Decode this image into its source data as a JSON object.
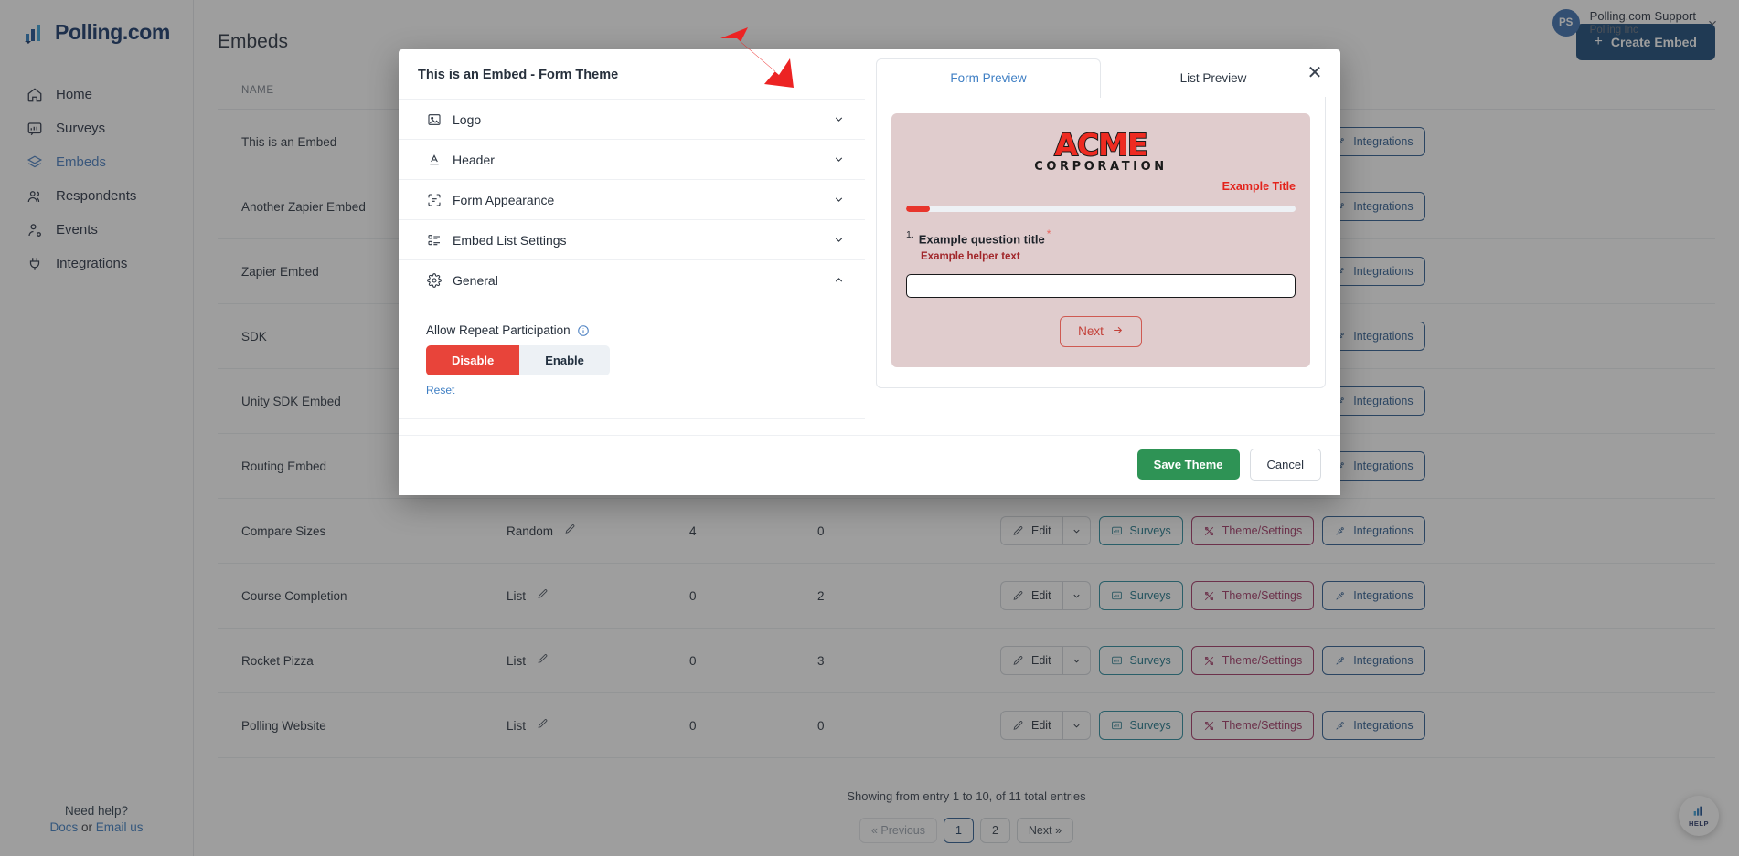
{
  "brand": {
    "name": "Polling.com"
  },
  "sidebar": {
    "items": [
      {
        "label": "Home",
        "icon": "home-icon",
        "active": false
      },
      {
        "label": "Surveys",
        "icon": "survey-icon",
        "active": false
      },
      {
        "label": "Embeds",
        "icon": "layers-icon",
        "active": true
      },
      {
        "label": "Respondents",
        "icon": "users-icon",
        "active": false
      },
      {
        "label": "Events",
        "icon": "user-event-icon",
        "active": false
      },
      {
        "label": "Integrations",
        "icon": "plug-icon",
        "active": false
      }
    ],
    "help": {
      "title": "Need help?",
      "docs": "Docs",
      "or": " or ",
      "email": "Email us"
    }
  },
  "topbar": {
    "avatar_initials": "PS",
    "user_name": "Polling.com Support",
    "user_org": "Polling Inc"
  },
  "page": {
    "title": "Embeds",
    "create_button": "Create Embed",
    "create_plus": "+"
  },
  "table": {
    "columns": [
      "NAME",
      "",
      "",
      "",
      ""
    ],
    "rows": [
      {
        "name": "This is an Embed",
        "type": "",
        "n1": "",
        "n2": ""
      },
      {
        "name": "Another Zapier Embed",
        "type": "",
        "n1": "",
        "n2": ""
      },
      {
        "name": "Zapier Embed",
        "type": "",
        "n1": "",
        "n2": ""
      },
      {
        "name": "SDK",
        "type": "",
        "n1": "",
        "n2": ""
      },
      {
        "name": "Unity SDK Embed",
        "type": "",
        "n1": "",
        "n2": ""
      },
      {
        "name": "Routing Embed",
        "type": "",
        "n1": "",
        "n2": ""
      },
      {
        "name": "Compare Sizes",
        "type": "Random",
        "n1": "4",
        "n2": "0"
      },
      {
        "name": "Course Completion",
        "type": "List",
        "n1": "0",
        "n2": "2"
      },
      {
        "name": "Rocket Pizza",
        "type": "List",
        "n1": "0",
        "n2": "3"
      },
      {
        "name": "Polling Website",
        "type": "List",
        "n1": "0",
        "n2": "0"
      }
    ],
    "row_actions": {
      "edit": "Edit",
      "surveys": "Surveys",
      "theme": "Theme/Settings",
      "integrations": "Integrations"
    }
  },
  "footer": {
    "summary": "Showing from entry 1 to 10, of 11 total entries",
    "pager": {
      "previous": "« Previous",
      "pages": [
        "1",
        "2"
      ],
      "current": "1",
      "next": "Next »"
    }
  },
  "help_fab": {
    "label": "HELP"
  },
  "modal": {
    "title": "This is an Embed - Form Theme",
    "close_label": "✕",
    "sections": [
      {
        "label": "Logo",
        "icon": "image-icon",
        "expanded": false
      },
      {
        "label": "Header",
        "icon": "text-format-icon",
        "expanded": false
      },
      {
        "label": "Form Appearance",
        "icon": "form-appearance-icon",
        "expanded": false
      },
      {
        "label": "Embed List Settings",
        "icon": "list-settings-icon",
        "expanded": false
      },
      {
        "label": "General",
        "icon": "gear-icon",
        "expanded": true
      }
    ],
    "general": {
      "field_label": "Allow Repeat Participation",
      "disable_label": "Disable",
      "enable_label": "Enable",
      "selected": "Disable",
      "reset_label": "Reset"
    },
    "tabs": [
      {
        "label": "Form Preview",
        "active": true
      },
      {
        "label": "List Preview",
        "active": false
      }
    ],
    "preview": {
      "logo_main": "ACME",
      "logo_sub": "CORPORATION",
      "example_title": "Example Title",
      "progress_percent": 6,
      "question_number": "1.",
      "question_title": "Example question title",
      "required_marker": "*",
      "helper_text": "Example helper text",
      "input_value": "",
      "next_label": "Next"
    },
    "save_label": "Save Theme",
    "cancel_label": "Cancel"
  },
  "colors": {
    "accent_blue": "#3f7fc4",
    "brand_navy": "#17376b",
    "danger_red": "#e8443a",
    "success_green": "#2e9355",
    "preview_bg": "#e0cccd",
    "arrow_red": "#ec2323"
  }
}
